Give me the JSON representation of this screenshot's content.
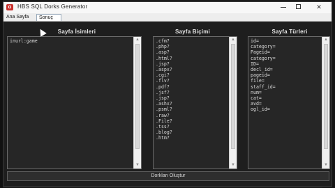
{
  "window": {
    "title": "HBS SQL Dorks Generator",
    "min_icon": "minimize-icon",
    "max_icon": "maximize-icon",
    "close_glyph": "✕"
  },
  "tabs": [
    {
      "label": "Ana Sayfa",
      "active": false
    },
    {
      "label": "Sonuç",
      "active": true
    }
  ],
  "columns": [
    {
      "title": "Sayfa İsimleri",
      "lines": [
        "inurl:game"
      ]
    },
    {
      "title": "Sayfa Biçimi",
      "lines": [
        ".cfm?",
        ".php?",
        ".asp?",
        ".html?",
        ".jsp?",
        ".aspx?",
        ".cgi?",
        ".flv?",
        ".pdf?",
        ".jsf?",
        ".jsp?",
        ".ashx?",
        ".psml?",
        ".raw?",
        ".File?",
        ".tss?",
        ".blog?",
        ".htm?"
      ]
    },
    {
      "title": "Sayfa Türleri",
      "lines": [
        "id=",
        "category=",
        "Pageid=",
        "category=",
        "ID=",
        "decl_id=",
        "pageid=",
        "file=",
        "staff_id=",
        "num=",
        "cat=",
        "avd=",
        "ogl_id="
      ]
    }
  ],
  "generate_button": {
    "label": "Dorkları Oluştur"
  },
  "colors": {
    "background": "#1e1e1e",
    "titlebar": "#f7f7f7",
    "app_icon": "#c9302c",
    "list_border": "#6a6a6a"
  }
}
